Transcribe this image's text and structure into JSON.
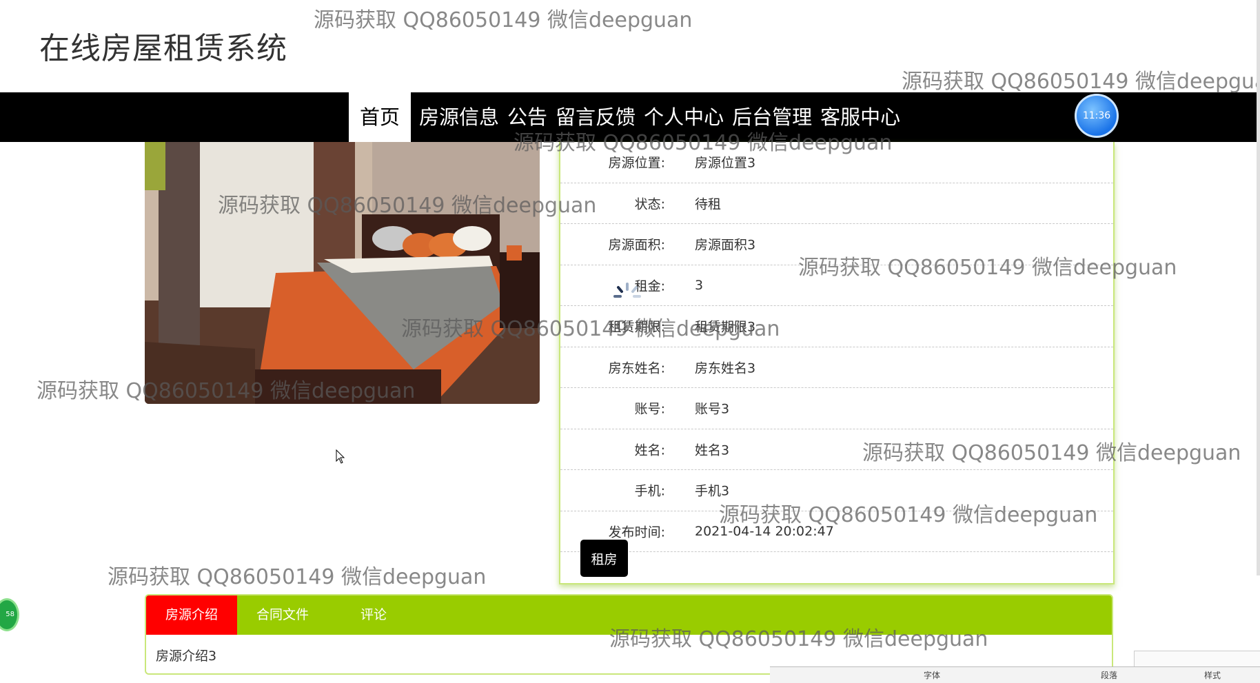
{
  "site": {
    "title": "在线房屋租赁系统"
  },
  "nav": {
    "items": [
      {
        "label": "首页",
        "active": true
      },
      {
        "label": "房源信息",
        "active": false
      },
      {
        "label": "公告",
        "active": false
      },
      {
        "label": "留言反馈",
        "active": false
      },
      {
        "label": "个人中心",
        "active": false
      },
      {
        "label": "后台管理",
        "active": false
      },
      {
        "label": "客服中心",
        "active": false
      }
    ],
    "clock": "11:36"
  },
  "details": [
    {
      "label": "房源位置:",
      "value": "房源位置3"
    },
    {
      "label": "状态:",
      "value": "待租"
    },
    {
      "label": "房源面积:",
      "value": "房源面积3"
    },
    {
      "label": "租金:",
      "value": "3"
    },
    {
      "label": "租赁期限:",
      "value": "租赁期限3"
    },
    {
      "label": "房东姓名:",
      "value": "房东姓名3"
    },
    {
      "label": "账号:",
      "value": "账号3"
    },
    {
      "label": "姓名:",
      "value": "姓名3"
    },
    {
      "label": "手机:",
      "value": "手机3"
    },
    {
      "label": "发布时间:",
      "value": "2021-04-14 20:02:47"
    }
  ],
  "rent_button": "租房",
  "tabs": {
    "items": [
      {
        "label": "房源介绍",
        "active": true
      },
      {
        "label": "合同文件",
        "active": false
      },
      {
        "label": "评论",
        "active": false
      }
    ],
    "content": "房源介绍3"
  },
  "watermark_text": "源码获取 QQ86050149 微信deepguan",
  "side_badge": "58",
  "taskbar": {
    "labels": [
      "字体",
      "段落",
      "样式"
    ]
  },
  "colors": {
    "nav_bg": "#000000",
    "accent_green": "#99cc00",
    "tab_active": "#ff0000"
  }
}
